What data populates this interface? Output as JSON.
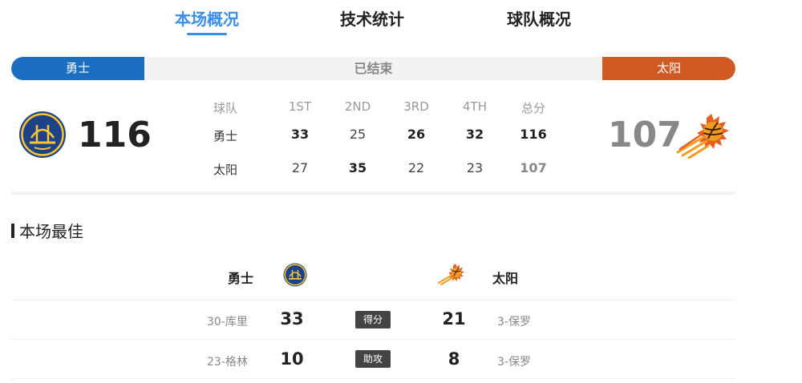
{
  "tabs": [
    {
      "label": "本场概况",
      "active": true
    },
    {
      "label": "技术统计",
      "active": false
    },
    {
      "label": "球队概况",
      "active": false
    }
  ],
  "status": {
    "left_team": "勇士",
    "right_team": "太阳",
    "text": "已结束",
    "left_color": "#1b6ec0",
    "right_color": "#d15a24"
  },
  "scores": {
    "left": "116",
    "right": "107"
  },
  "quarters": {
    "headers": [
      "球队",
      "1ST",
      "2ND",
      "3RD",
      "4TH",
      "总分"
    ],
    "rows": [
      {
        "team": "勇士",
        "q": [
          "33",
          "25",
          "26",
          "32"
        ],
        "total": "116"
      },
      {
        "team": "太阳",
        "q": [
          "27",
          "35",
          "22",
          "23"
        ],
        "total": "107"
      }
    ]
  },
  "best": {
    "title": "本场最佳",
    "left_team": "勇士",
    "right_team": "太阳",
    "rows": [
      {
        "left_player": "30-库里",
        "left_value": "33",
        "stat": "得分",
        "right_value": "21",
        "right_player": "3-保罗"
      },
      {
        "left_player": "23-格林",
        "left_value": "10",
        "stat": "助攻",
        "right_value": "8",
        "right_player": "3-保罗"
      }
    ]
  },
  "icons": {
    "warriors": "warriors-logo-icon",
    "suns": "suns-logo-icon"
  }
}
